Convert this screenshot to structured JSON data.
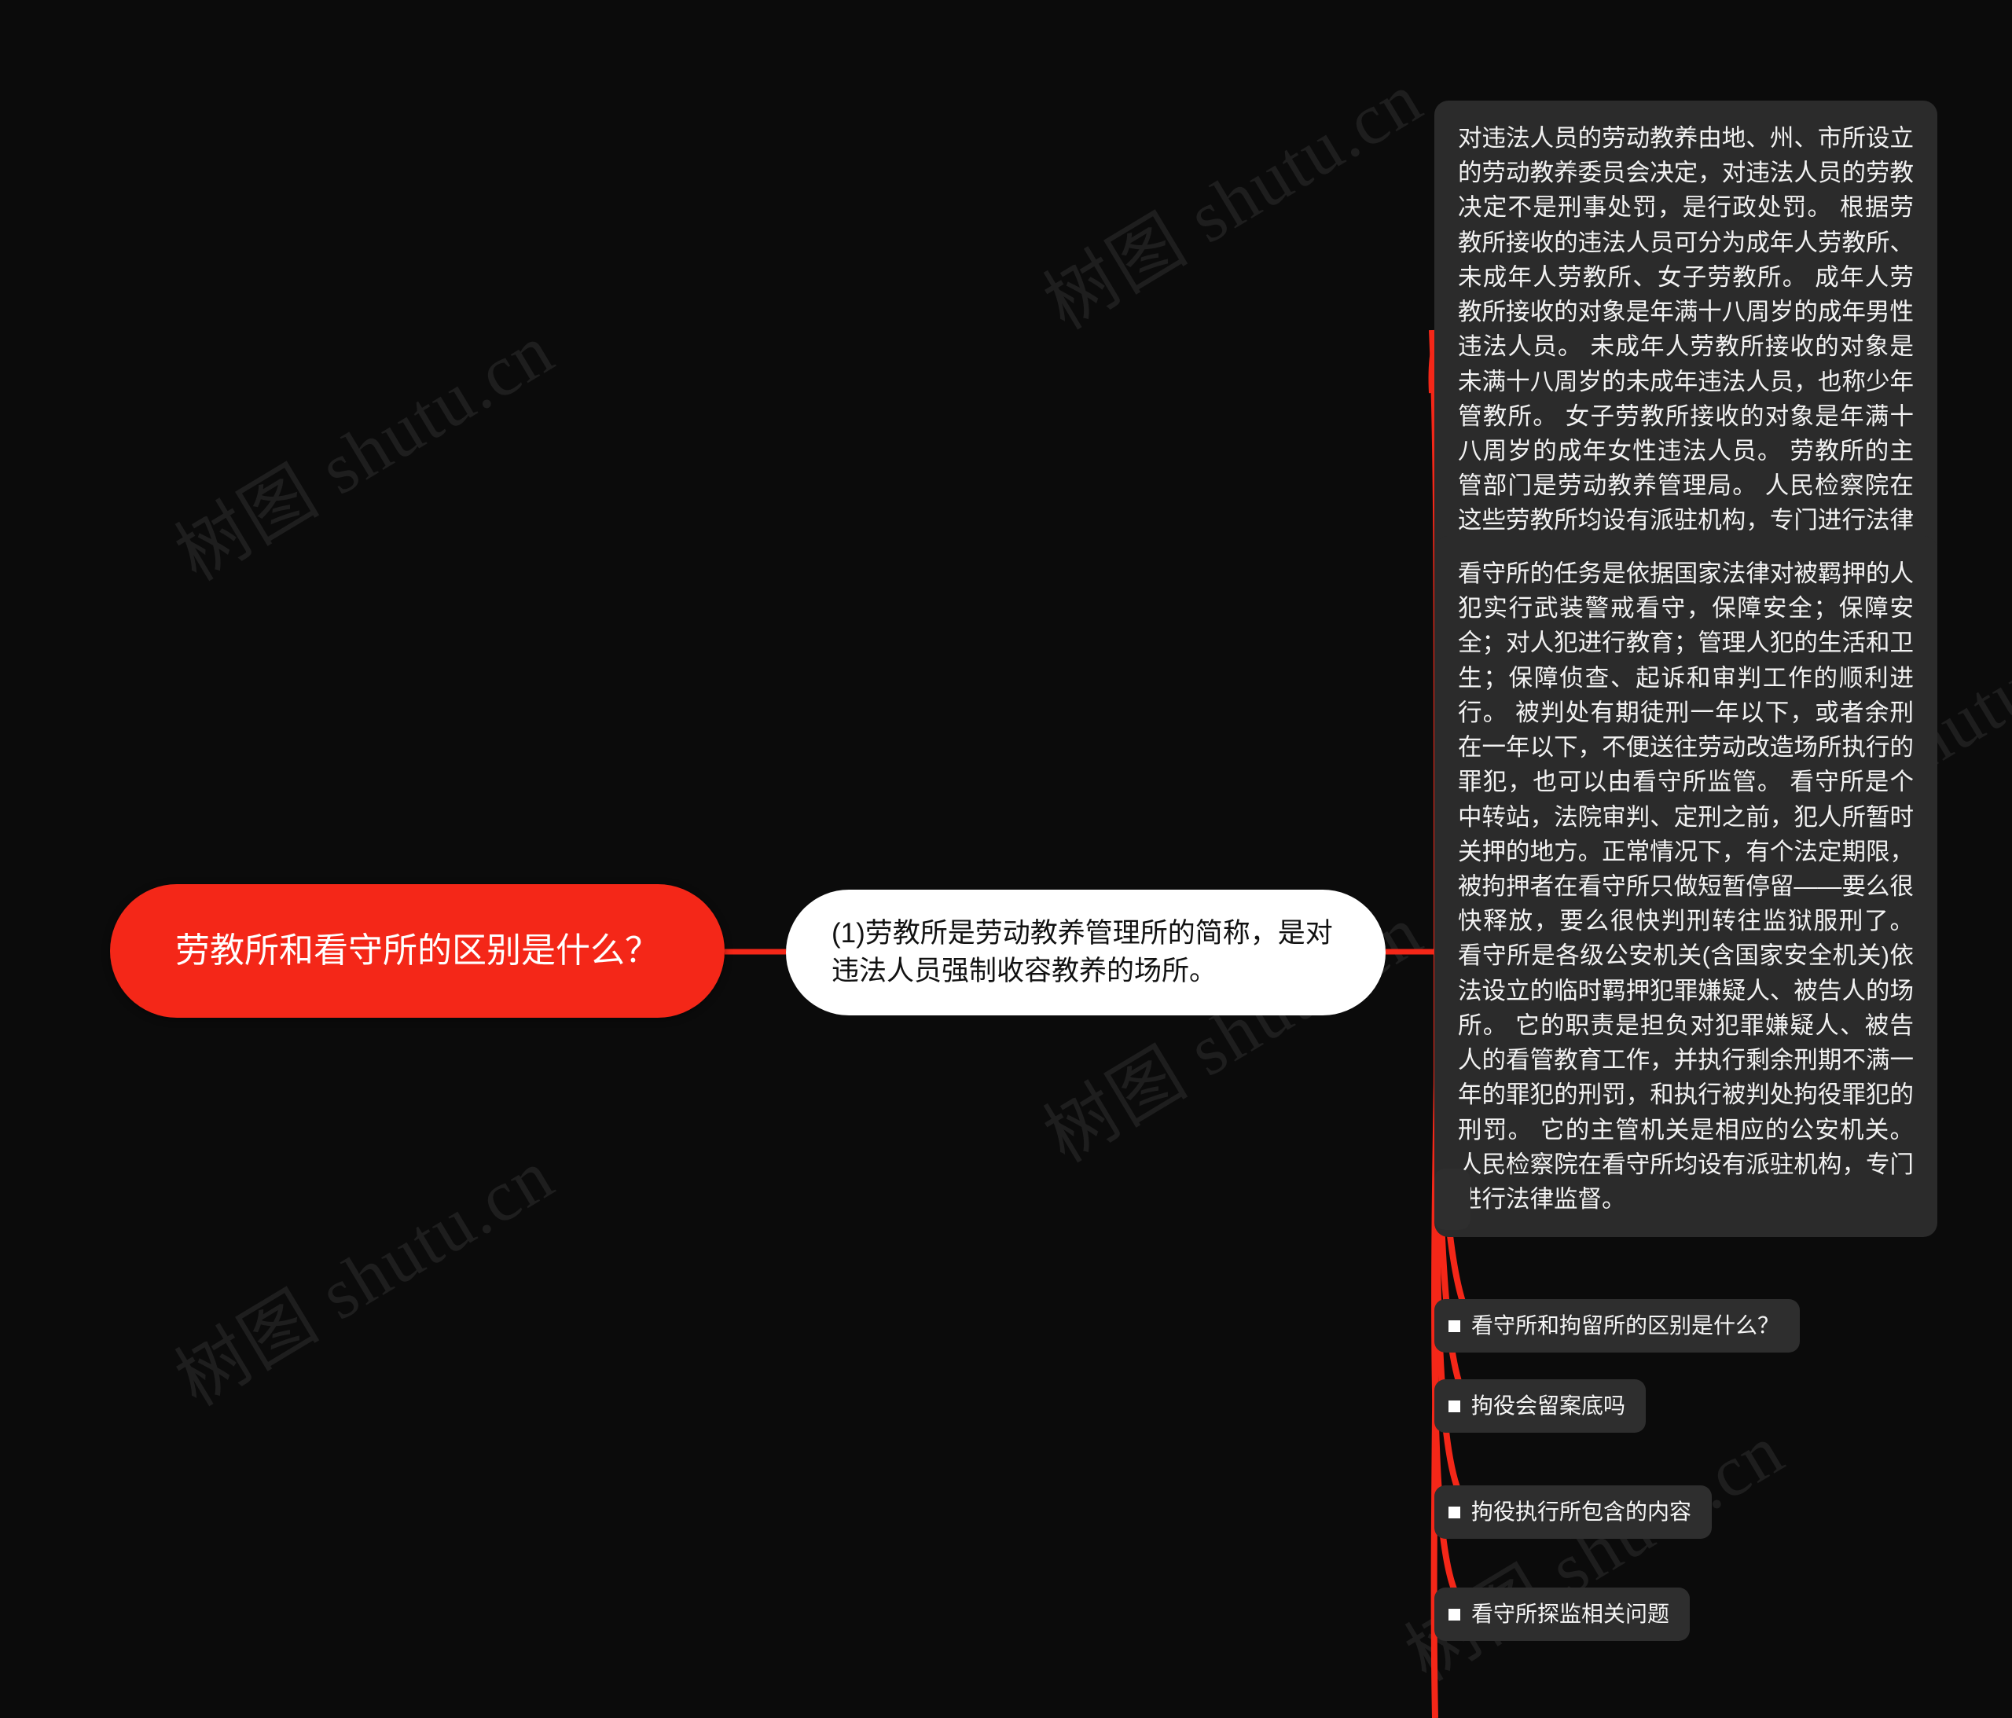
{
  "canvas": {
    "background": "#0b0b0b",
    "accent": "#f42718",
    "node_dark": "#2b2b2b",
    "node_white": "#ffffff"
  },
  "watermark": {
    "text": "树图 shutu.cn",
    "color": "#1e1e1e"
  },
  "mindmap": {
    "root": {
      "label": "劳教所和看守所的区别是什么？"
    },
    "branch": {
      "label": "(1)劳教所是劳动教养管理所的简称，是对违法人员强制收容教养的场所。"
    },
    "paragraphs": [
      {
        "text": "对违法人员的劳动教养由地、州、市所设立的劳动教养委员会决定，对违法人员的劳教决定不是刑事处罚，是行政处罚。 根据劳教所接收的违法人员可分为成年人劳教所、未成年人劳教所、女子劳教所。 成年人劳教所接收的对象是年满十八周岁的成年男性违法人员。 未成年人劳教所接收的对象是未满十八周岁的未成年违法人员，也称少年管教所。 女子劳教所接收的对象是年满十八周岁的成年女性违法人员。 劳教所的主管部门是劳动教养管理局。 人民检察院在这些劳教所均设有派驻机构，专门进行法律监督。"
      },
      {
        "text": "看守所的任务是依据国家法律对被羁押的人犯实行武装警戒看守，保障安全；保障安全；对人犯进行教育；管理人犯的生活和卫生；保障侦查、起诉和审判工作的顺利进行。 被判处有期徒刑一年以下，或者余刑在一年以下，不便送往劳动改造场所执行的罪犯，也可以由看守所监管。 看守所是个中转站，法院审判、定刑之前，犯人所暂时关押的地方。正常情况下，有个法定期限，被拘押者在看守所只做短暂停留——要么很快释放，要么很快判刑转往监狱服刑了。 看守所是各级公安机关(含国家安全机关)依法设立的临时羁押犯罪嫌疑人、被告人的场所。 它的职责是担负对犯罪嫌疑人、被告人的看管教育工作，并执行剩余刑期不满一年的罪犯的刑罚，和执行被判处拘役罪犯的刑罚。 它的主管机关是相应的公安机关。 人民检察院在看守所均设有派驻机构，专门进行法律监督。"
      }
    ],
    "leaves": [
      {
        "label": ""
      },
      {
        "label": "看守所和拘留所的区别是什么？"
      },
      {
        "label": "拘役会留案底吗"
      },
      {
        "label": "拘役执行所包含的内容"
      },
      {
        "label": "看守所探监相关问题"
      }
    ]
  }
}
